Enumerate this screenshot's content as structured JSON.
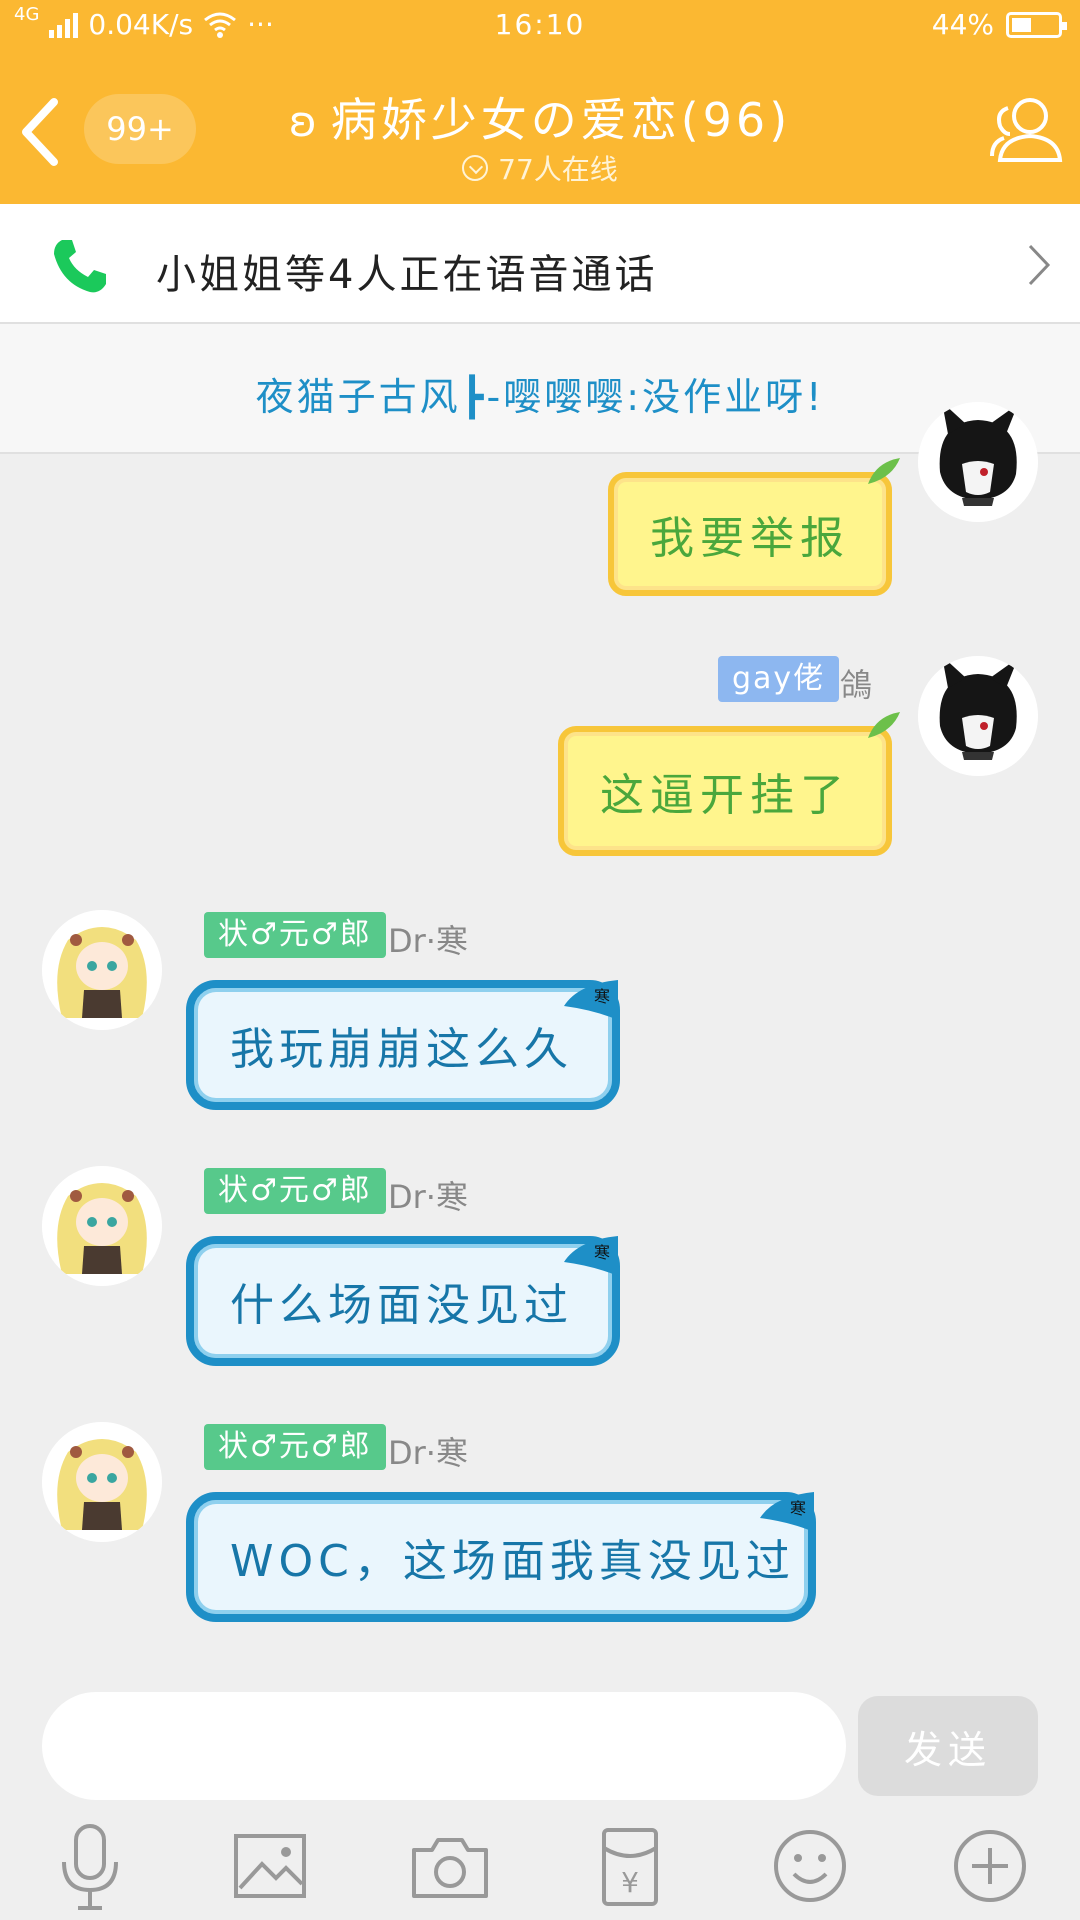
{
  "status_bar": {
    "network": "4G",
    "speed": "0.04K/s",
    "more": "···",
    "time": "16:10",
    "battery": "44%"
  },
  "header": {
    "back_badge": "99+",
    "title": "病娇少女の爱恋(96)",
    "online": "77人在线"
  },
  "voice_call": {
    "text": "小姐姐等4人正在语音通话"
  },
  "notice": {
    "text": "夜猫子古风┣-嘤嘤嘤:没作业呀!"
  },
  "messages": [
    {
      "side": "right",
      "style": "yellow",
      "text": "我要举报"
    },
    {
      "side": "right",
      "style": "yellow",
      "tag": "gay佬",
      "nick": "鴿",
      "text": "这逼开挂了"
    },
    {
      "side": "left",
      "style": "blue",
      "tag": "状♂元♂郎",
      "nick": "Dr·寒",
      "text": "我玩崩崩这么久",
      "flag": "寒"
    },
    {
      "side": "left",
      "style": "blue",
      "tag": "状♂元♂郎",
      "nick": "Dr·寒",
      "text": "什么场面没见过",
      "flag": "寒"
    },
    {
      "side": "left",
      "style": "blue",
      "tag": "状♂元♂郎",
      "nick": "Dr·寒",
      "text": "WOC，这场面我真没见过",
      "flag": "寒"
    }
  ],
  "composer": {
    "input_value": "",
    "send_label": "发送"
  },
  "toolbar": {
    "items": [
      "microphone-icon",
      "image-icon",
      "camera-icon",
      "red-packet-icon",
      "emoji-icon",
      "plus-icon"
    ],
    "red_packet_glyph": "¥"
  },
  "colors": {
    "header": "#fbb832",
    "notice_text": "#1e8fc7",
    "tag_blue": "#8db7f0",
    "tag_green": "#57c98b",
    "bubble_blue_border": "#1e8fc7",
    "bubble_yellow": "#fff58d"
  }
}
